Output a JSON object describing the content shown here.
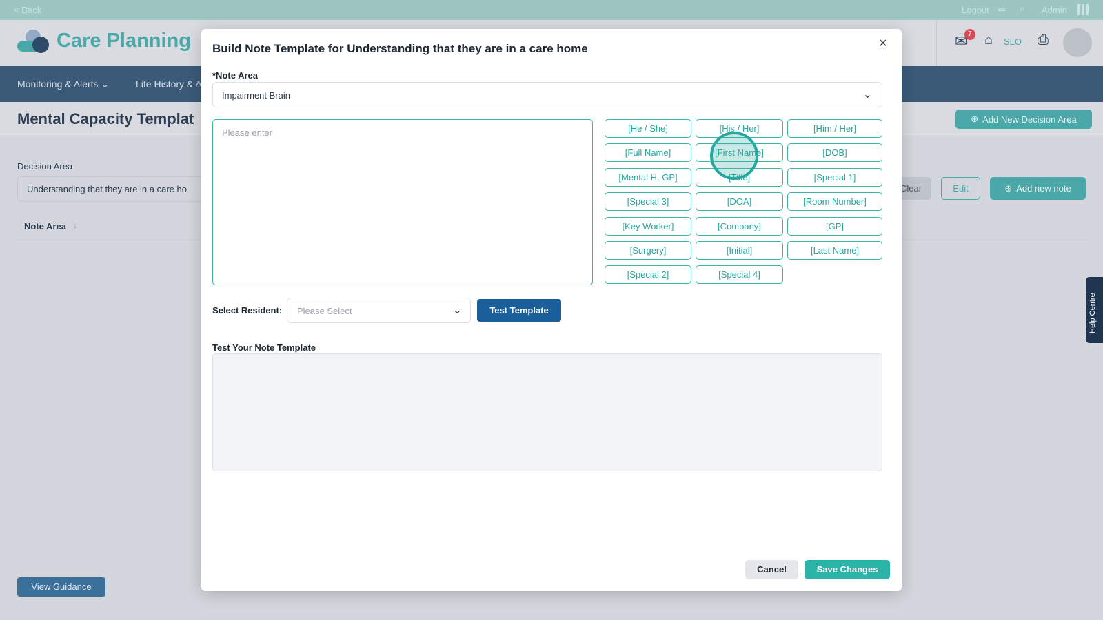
{
  "topbar": {
    "back": "< Back",
    "logout": "Logout",
    "admin": "Admin"
  },
  "header": {
    "app_title": "Care Planning",
    "mail_badge": "7",
    "home_label": "SLO"
  },
  "nav": {
    "items": [
      "Monitoring & Alerts",
      "Life History & A"
    ]
  },
  "page": {
    "title": "Mental Capacity Templat",
    "add_decision_area": "Add New Decision Area",
    "decision_area_label": "Decision Area",
    "decision_area_value": "Understanding that they are in a care ho",
    "clear": "Clear",
    "edit": "Edit",
    "add_new_note": "Add new note",
    "column_note_area": "Note Area",
    "view_guidance": "View Guidance",
    "help_centre": "Help Centre"
  },
  "modal": {
    "title": "Build Note Template for Understanding that they are in a care home",
    "note_area_label": "*Note Area",
    "note_area_value": "Impairment Brain",
    "textarea_placeholder": "Please enter",
    "chips": [
      "[He / She]",
      "[His / Her]",
      "[Him / Her]",
      "[Full Name]",
      "[First Name]",
      "[DOB]",
      "[Mental H. GP]",
      "[Title]",
      "[Special 1]",
      "[Special 3]",
      "[DOA]",
      "[Room Number]",
      "[Key Worker]",
      "[Company]",
      "[GP]",
      "[Surgery]",
      "[Initial]",
      "[Last Name]",
      "[Special 2]",
      "[Special 4]"
    ],
    "select_resident_label": "Select Resident:",
    "select_resident_placeholder": "Please Select",
    "test_template": "Test Template",
    "test_label": "Test Your Note Template",
    "cancel": "Cancel",
    "save": "Save Changes"
  }
}
